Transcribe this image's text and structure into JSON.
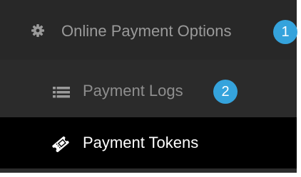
{
  "menu": {
    "items": [
      {
        "label": "Online Payment Options",
        "icon": "gear-icon",
        "active": false
      },
      {
        "label": "Payment Logs",
        "icon": "list-icon",
        "active": false
      },
      {
        "label": "Payment Tokens",
        "icon": "ticket-icon",
        "active": true
      }
    ]
  },
  "badges": [
    "1",
    "2"
  ],
  "colors": {
    "menu_background": "#2b2b2b",
    "active_background": "#000000",
    "inactive_text": "#999999",
    "active_text": "#ffffff",
    "badge": "#35a3dc"
  }
}
